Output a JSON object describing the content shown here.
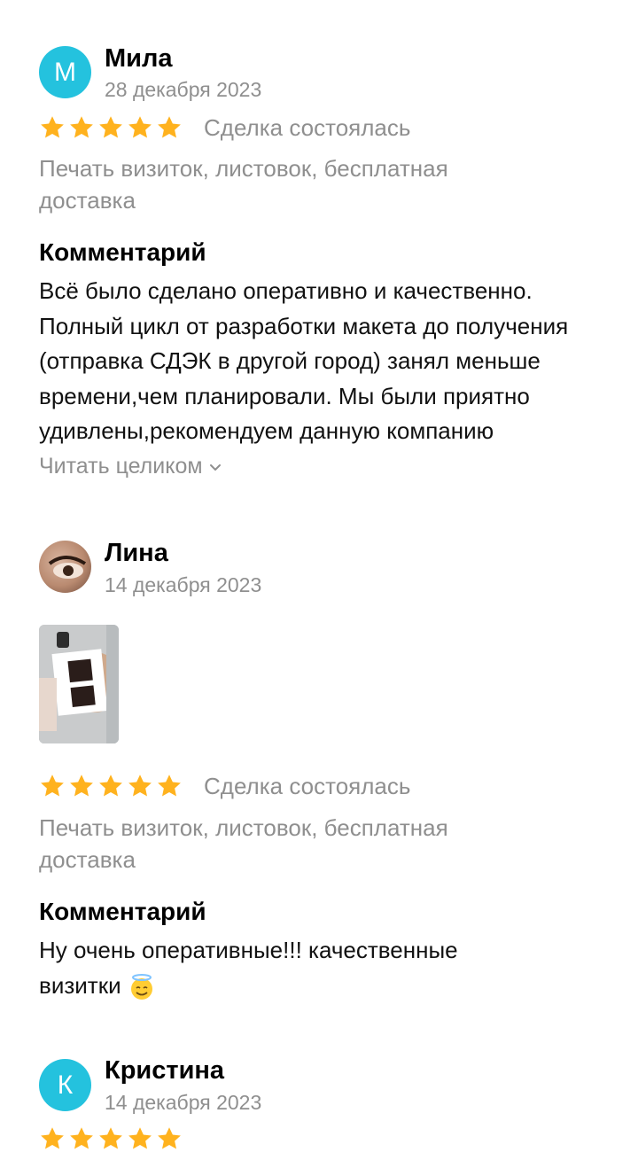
{
  "reviews": [
    {
      "avatar_letter": "М",
      "name": "Мила",
      "date": "28 декабря 2023",
      "rating": 5,
      "deal_status": "Сделка состоялась",
      "service": "Печать визиток, листовок, бесплатная доставка",
      "comment_heading": "Комментарий",
      "comment": "Всё было сделано оперативно и качественно. Полный цикл от разработки макета до получения (отправка СДЭК в другой город) занял меньше времени,чем планировали. Мы были приятно удивлены,рекомендуем данную компанию",
      "read_more": "Читать целиком"
    },
    {
      "name": "Лина",
      "date": "14 декабря 2023",
      "rating": 5,
      "deal_status": "Сделка состоялась",
      "service": "Печать визиток, листовок, бесплатная доставка",
      "comment_heading": "Комментарий",
      "comment": "Ну очень оперативные!!!  качественные визитки",
      "comment_emoji": "smiling-face-with-halo"
    },
    {
      "avatar_letter": "К",
      "name": "Кристина",
      "date": "14 декабря 2023",
      "rating": 5
    }
  ],
  "colors": {
    "avatar": "#24c2de",
    "star": "#ffb21e",
    "muted_text": "#8f8f8f"
  }
}
